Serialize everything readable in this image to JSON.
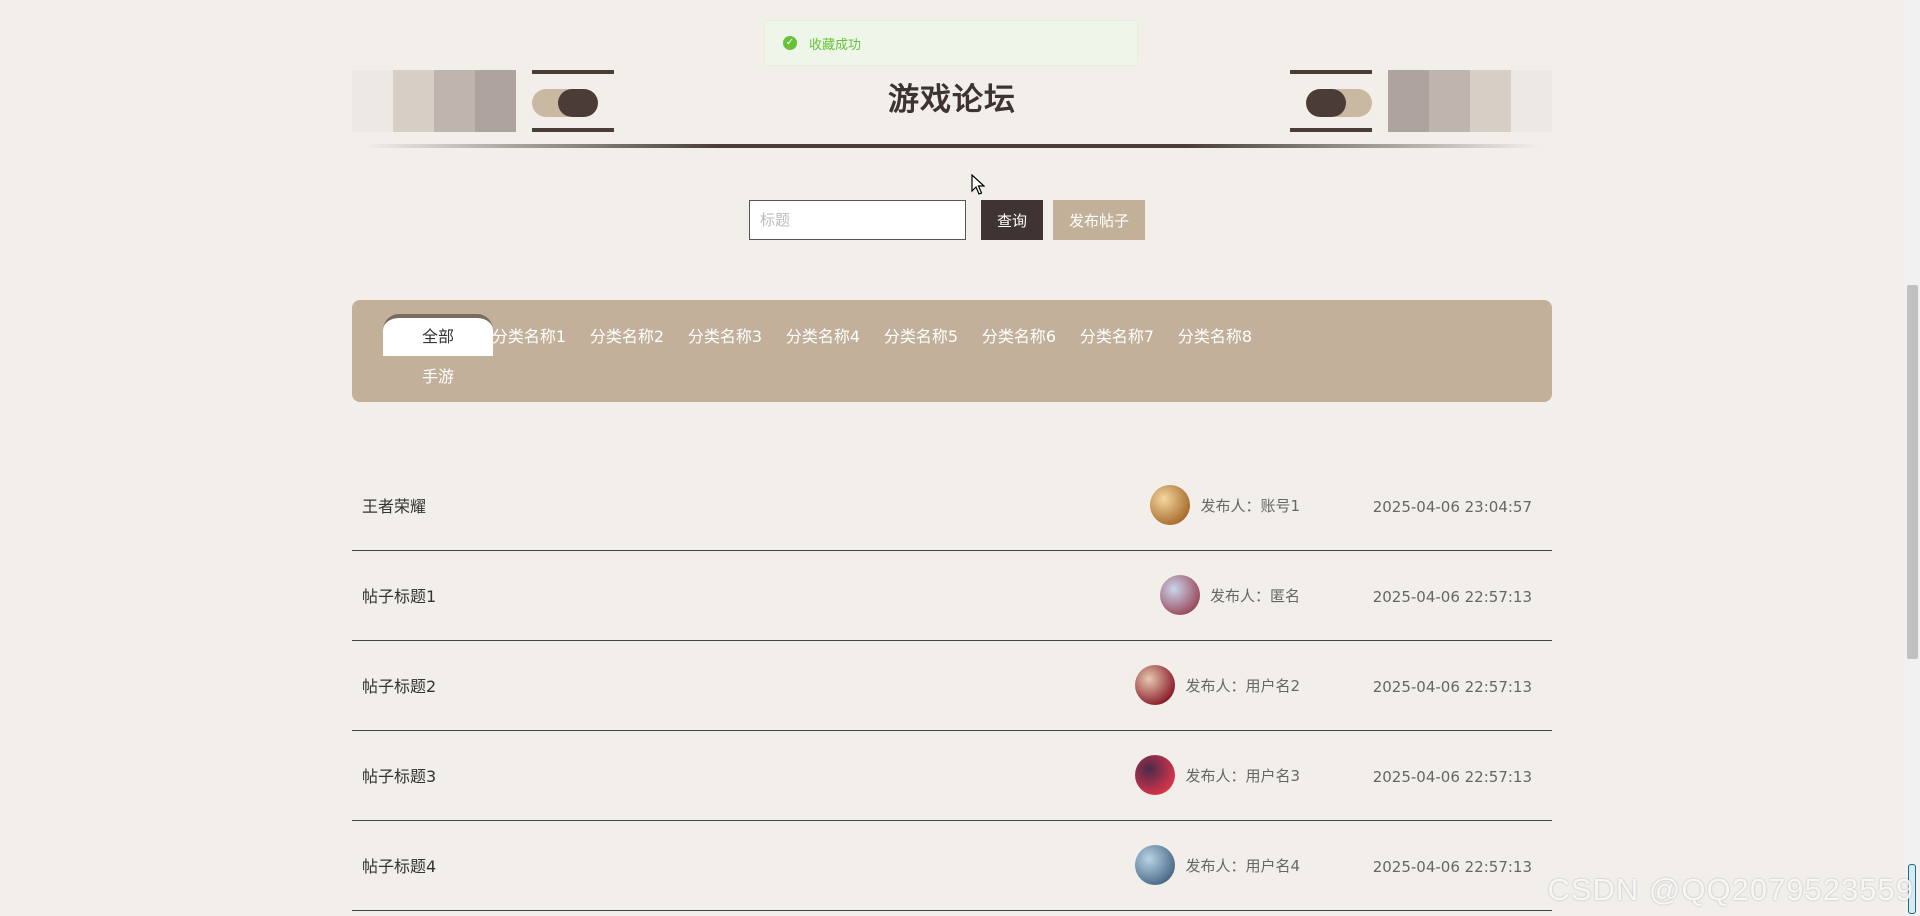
{
  "toast": {
    "text": "收藏成功",
    "icon": "check-circle-icon"
  },
  "header": {
    "title": "游戏论坛",
    "palette": [
      "#ece8e3",
      "#d7cfc6",
      "#bfb5ae",
      "#aea39f"
    ]
  },
  "search": {
    "placeholder": "标题",
    "value": "",
    "query_label": "查询",
    "post_label": "发布帖子"
  },
  "categories": {
    "active_index": 0,
    "items": [
      {
        "label": "全部"
      },
      {
        "label": "分类名称1"
      },
      {
        "label": "分类名称2"
      },
      {
        "label": "分类名称3"
      },
      {
        "label": "分类名称4"
      },
      {
        "label": "分类名称5"
      },
      {
        "label": "分类名称6"
      },
      {
        "label": "分类名称7"
      },
      {
        "label": "分类名称8"
      },
      {
        "label": "手游"
      }
    ]
  },
  "posts": [
    {
      "title": "王者荣耀",
      "author_text": "发布人：账号1",
      "time": "2025-04-06 23:04:57",
      "avatar_colors": [
        "#f3d7a0",
        "#a86b2c"
      ]
    },
    {
      "title": "帖子标题1",
      "author_text": "发布人：匿名",
      "time": "2025-04-06 22:57:13",
      "avatar_colors": [
        "#c9d6ec",
        "#9a4a5e"
      ]
    },
    {
      "title": "帖子标题2",
      "author_text": "发布人：用户名2",
      "time": "2025-04-06 22:57:13",
      "avatar_colors": [
        "#e6c9b0",
        "#8a1c2b"
      ]
    },
    {
      "title": "帖子标题3",
      "author_text": "发布人：用户名3",
      "time": "2025-04-06 22:57:13",
      "avatar_colors": [
        "#4a2a4a",
        "#d8344a"
      ]
    },
    {
      "title": "帖子标题4",
      "author_text": "发布人：用户名4",
      "time": "2025-04-06 22:57:13",
      "avatar_colors": [
        "#b7d4e6",
        "#4b6a86"
      ]
    }
  ],
  "watermark": "CSDN @QQ2079523559",
  "colors": {
    "accent_dark": "#3f3431",
    "accent_tan": "#c3b099",
    "background": "#f2efeb",
    "toast_green": "#67c23a"
  }
}
